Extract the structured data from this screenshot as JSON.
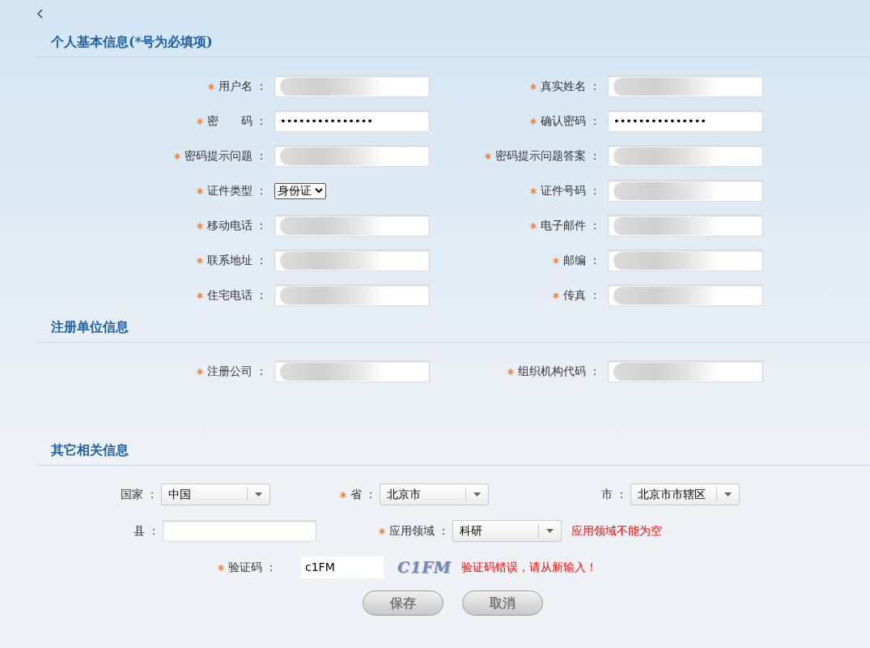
{
  "sections": [
    {
      "title": "个人基本信息(*号为必填项)",
      "kind": "pairs",
      "fields": [
        {
          "label": "用户名 ：",
          "required": true,
          "kind": "text",
          "redacted": true
        },
        {
          "label": "真实姓名 ：",
          "required": true,
          "kind": "text",
          "redacted": true
        },
        {
          "label": "密　　码 ：",
          "required": true,
          "kind": "text",
          "value": "•••••••••••••••"
        },
        {
          "label": "确认密码 ：",
          "required": true,
          "kind": "text",
          "value": "•••••••••••••••"
        },
        {
          "label": "密码提示问题 ：",
          "required": true,
          "kind": "text",
          "redacted": true
        },
        {
          "label": "密码提示问题答案 ：",
          "required": true,
          "kind": "text",
          "redacted": true
        },
        {
          "label": "证件类型 ：",
          "required": true,
          "kind": "select",
          "value": "身份证"
        },
        {
          "label": "证件号码 ：",
          "required": true,
          "kind": "text",
          "redacted": true
        },
        {
          "label": "移动电话 ：",
          "required": true,
          "kind": "text",
          "redacted": true
        },
        {
          "label": "电子邮件 ：",
          "required": true,
          "kind": "text",
          "redacted": true
        },
        {
          "label": "联系地址 ：",
          "required": true,
          "kind": "text",
          "redacted": true
        },
        {
          "label": "邮编 ：",
          "required": true,
          "kind": "text",
          "redacted": true
        },
        {
          "label": "住宅电话 ：",
          "required": true,
          "kind": "text",
          "redacted": true
        },
        {
          "label": "传真 ：",
          "required": true,
          "kind": "text",
          "redacted": true
        }
      ]
    },
    {
      "title": "注册单位信息",
      "kind": "pairs",
      "fields": [
        {
          "label": "注册公司 ：",
          "required": true,
          "kind": "text",
          "redacted": true
        },
        {
          "label": "组织机构代码 ：",
          "required": true,
          "kind": "text",
          "redacted": true
        }
      ]
    },
    {
      "title": "其它相关信息",
      "kind": "rows",
      "rows": [
        {
          "items": [
            {
              "label": "国家 ：",
              "required": false,
              "kind": "combo",
              "value": "中国"
            },
            {
              "label": "省 ：",
              "required": true,
              "kind": "combo",
              "value": "北京市"
            },
            {
              "label": "市 ：",
              "required": false,
              "kind": "combo",
              "value": "北京市市辖区"
            }
          ]
        },
        {
          "items": [
            {
              "label": "县 ：",
              "required": false,
              "kind": "text"
            },
            {
              "label": "应用领域 ：",
              "required": true,
              "kind": "combo",
              "value": "科研"
            }
          ],
          "error": "应用领域不能为空"
        },
        {
          "items": [
            {
              "label": "验证码 ：",
              "required": true,
              "kind": "captcha",
              "value": "c1FM",
              "image_text": "C1FM"
            }
          ],
          "error": "验证码错误，请从新输入！"
        }
      ]
    }
  ],
  "buttons": [
    "保存",
    "取消"
  ]
}
